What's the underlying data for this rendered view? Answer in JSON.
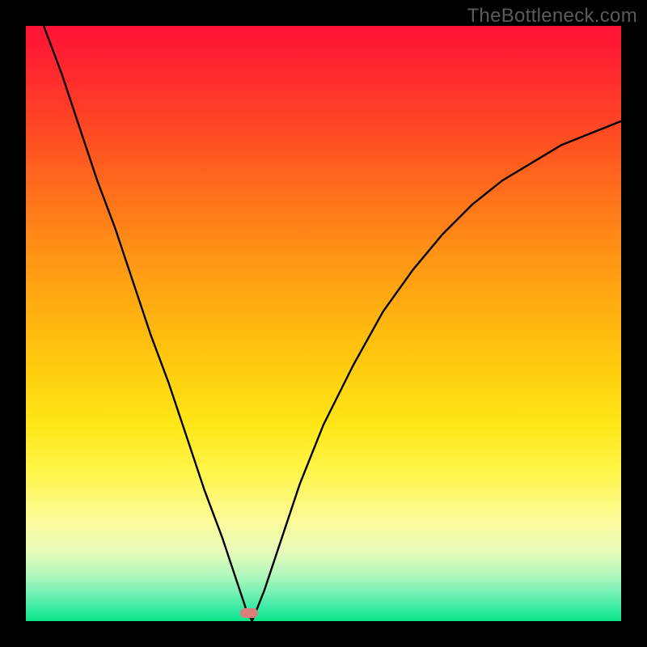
{
  "watermark": "TheBottleneck.com",
  "marker": {
    "x_frac": 0.375,
    "y_frac": 0.987
  },
  "chart_data": {
    "type": "line",
    "title": "",
    "xlabel": "",
    "ylabel": "",
    "xlim": [
      0,
      1
    ],
    "ylim": [
      0,
      1
    ],
    "series": [
      {
        "name": "curve",
        "x": [
          0.03,
          0.06,
          0.09,
          0.12,
          0.15,
          0.18,
          0.21,
          0.24,
          0.27,
          0.3,
          0.33,
          0.35,
          0.37,
          0.38,
          0.4,
          0.43,
          0.46,
          0.5,
          0.55,
          0.6,
          0.65,
          0.7,
          0.75,
          0.8,
          0.85,
          0.9,
          0.95,
          1.0
        ],
        "values": [
          1.0,
          0.92,
          0.83,
          0.74,
          0.66,
          0.57,
          0.48,
          0.4,
          0.31,
          0.22,
          0.14,
          0.08,
          0.02,
          0.0,
          0.05,
          0.14,
          0.23,
          0.33,
          0.43,
          0.52,
          0.59,
          0.65,
          0.7,
          0.74,
          0.77,
          0.8,
          0.82,
          0.84
        ]
      }
    ],
    "annotations": [
      {
        "type": "marker",
        "x": 0.375,
        "y": 0.013,
        "color": "#d97f7d",
        "shape": "rounded-rect"
      }
    ],
    "background_gradient": {
      "direction": "vertical",
      "stops": [
        {
          "pos": 0.0,
          "color": "#ff1236"
        },
        {
          "pos": 0.5,
          "color": "#ffce0e"
        },
        {
          "pos": 0.83,
          "color": "#fdfb9a"
        },
        {
          "pos": 1.0,
          "color": "#0be588"
        }
      ]
    }
  }
}
